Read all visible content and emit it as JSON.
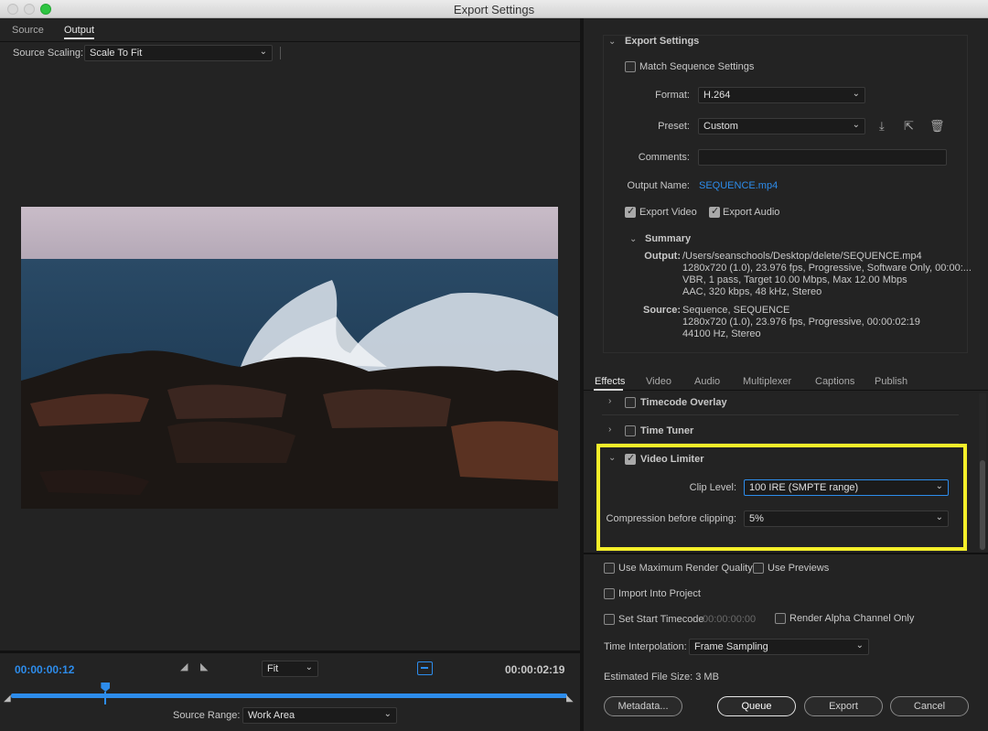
{
  "window": {
    "title": "Export Settings"
  },
  "preview_tabs": [
    {
      "label": "Source",
      "active": false
    },
    {
      "label": "Output",
      "active": true
    }
  ],
  "source_scaling": {
    "label": "Source Scaling:",
    "value": "Scale To Fit"
  },
  "timeline": {
    "current_time": "00:00:00:12",
    "end_time": "00:00:02:19",
    "zoom": "Fit",
    "playhead_fraction": 0.17,
    "source_range_label": "Source Range:",
    "source_range_value": "Work Area"
  },
  "export_settings": {
    "header": "Export Settings",
    "match_sequence": "Match Sequence Settings",
    "format_label": "Format:",
    "format_value": "H.264",
    "preset_label": "Preset:",
    "preset_value": "Custom",
    "comments_label": "Comments:",
    "comments_value": "",
    "output_name_label": "Output Name:",
    "output_name_value": "SEQUENCE.mp4",
    "export_video": "Export Video",
    "export_audio": "Export Audio"
  },
  "summary": {
    "header": "Summary",
    "output_label": "Output:",
    "output_lines": [
      "/Users/seanschools/Desktop/delete/SEQUENCE.mp4",
      "1280x720 (1.0), 23.976 fps, Progressive, Software Only, 00:00:...",
      "VBR, 1 pass, Target 10.00 Mbps, Max 12.00 Mbps",
      "AAC, 320 kbps, 48 kHz, Stereo"
    ],
    "source_label": "Source:",
    "source_lines": [
      "Sequence, SEQUENCE",
      "1280x720 (1.0), 23.976 fps, Progressive, 00:00:02:19",
      "44100 Hz, Stereo"
    ]
  },
  "settings_tabs": [
    "Effects",
    "Video",
    "Audio",
    "Multiplexer",
    "Captions",
    "Publish"
  ],
  "effects": {
    "timecode_overlay": "Timecode Overlay",
    "time_tuner": "Time Tuner",
    "video_limiter": "Video Limiter",
    "clip_level_label": "Clip Level:",
    "clip_level_value": "100 IRE (SMPTE range)",
    "compression_label": "Compression before clipping:",
    "compression_value": "5%"
  },
  "bottom": {
    "use_max_render": "Use Maximum Render Quality",
    "use_previews": "Use Previews",
    "import_into_project": "Import Into Project",
    "set_start_timecode": "Set Start Timecode",
    "start_timecode_value": "00:00:00:00",
    "render_alpha": "Render Alpha Channel Only",
    "time_interp_label": "Time Interpolation:",
    "time_interp_value": "Frame Sampling",
    "file_size": "Estimated File Size:  3 MB"
  },
  "buttons": {
    "metadata": "Metadata...",
    "queue": "Queue",
    "export": "Export",
    "cancel": "Cancel"
  },
  "colors": {
    "highlight": "#f5ef2a",
    "accent": "#2d8ceb"
  }
}
